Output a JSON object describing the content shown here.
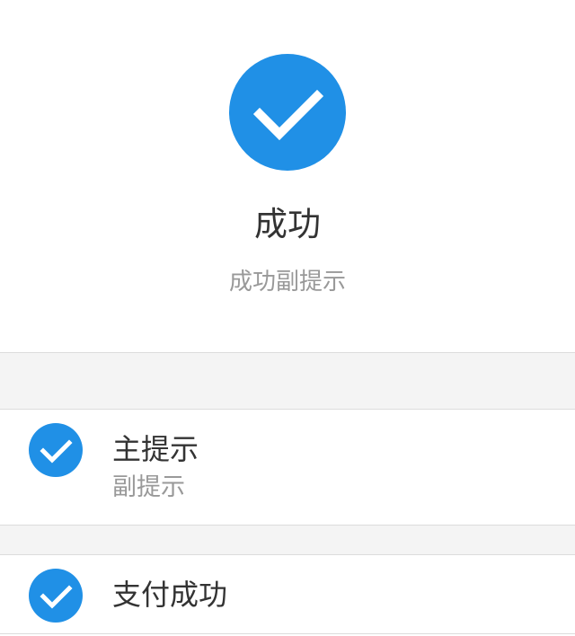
{
  "colors": {
    "accent": "#2090e6",
    "title_text": "#333333",
    "secondary_text": "#999999",
    "gap_background": "#f4f4f4",
    "divider": "#dcdcdc"
  },
  "result": {
    "icon": "success-check-icon",
    "title": "成功",
    "subtitle": "成功副提示"
  },
  "list_items": [
    {
      "icon": "success-check-icon",
      "title": "主提示",
      "subtitle": "副提示"
    },
    {
      "icon": "success-check-icon",
      "title": "支付成功"
    }
  ]
}
